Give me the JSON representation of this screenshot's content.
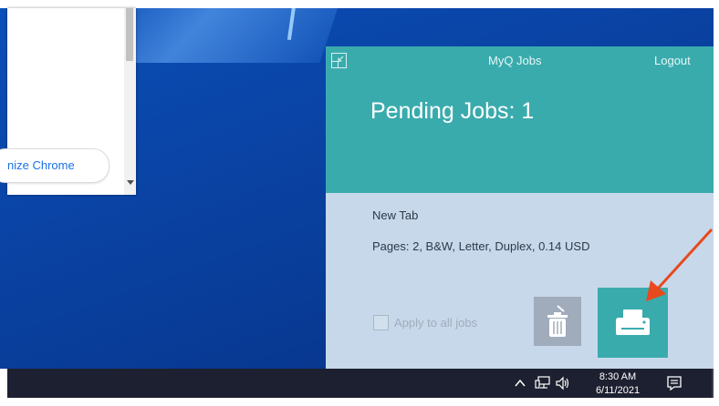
{
  "chrome": {
    "customize_label": "nize Chrome"
  },
  "myq": {
    "title": "MyQ Jobs",
    "logout": "Logout",
    "pending_label": "Pending Jobs: 1",
    "job": {
      "name": "New Tab",
      "details": "Pages: 2, B&W, Letter, Duplex, 0.14 USD"
    },
    "apply_all_label": "Apply to all jobs",
    "apply_all_checked": false,
    "colors": {
      "accent": "#3aabad",
      "body": "#c7d8ea",
      "delete_button": "#a0abbc"
    },
    "icons": {
      "collapse": "collapse-icon",
      "delete": "trash-icon",
      "print": "printer-icon"
    }
  },
  "annotation": {
    "color": "#e8491d",
    "points_to": "print-button"
  },
  "taskbar": {
    "time": "8:30 AM",
    "date": "6/11/2021",
    "icons": [
      "chevron-up-icon",
      "network-icon",
      "volume-icon",
      "notification-icon"
    ]
  }
}
